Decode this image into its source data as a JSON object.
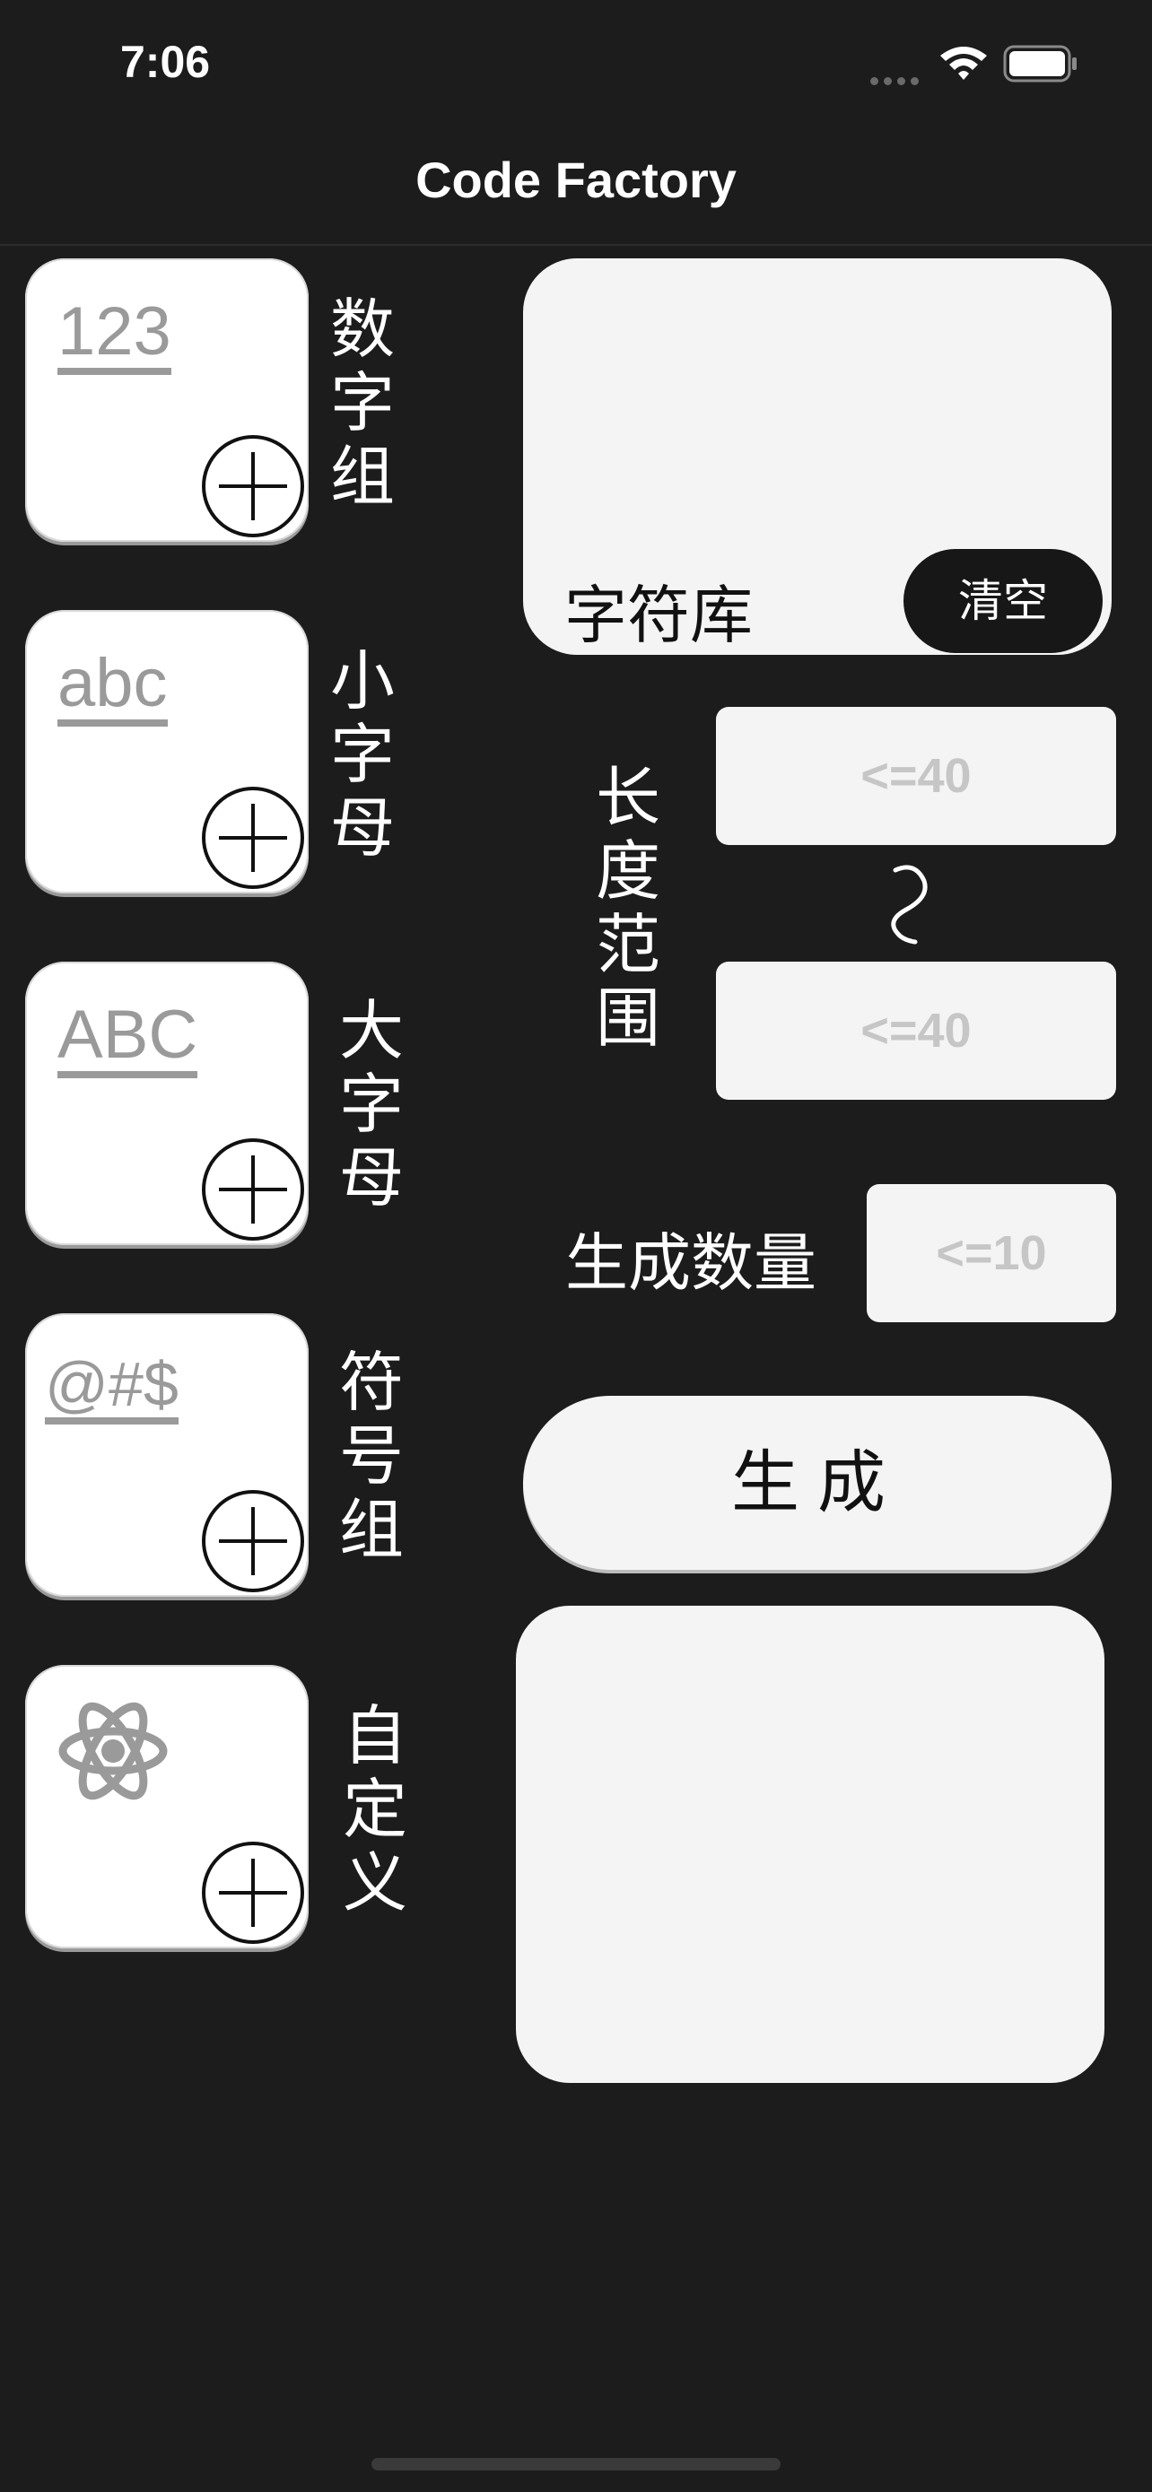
{
  "status_bar": {
    "time": "7:06"
  },
  "nav": {
    "title": "Code Factory"
  },
  "tiles": [
    {
      "glyph": "123",
      "label": "数字组"
    },
    {
      "glyph": "abc",
      "label": "小字母"
    },
    {
      "glyph": "ABC",
      "label": "大字母"
    },
    {
      "glyph": "@#$",
      "label": "符号组"
    },
    {
      "glyph": "",
      "label": "自定义"
    }
  ],
  "charset": {
    "label": "字符库",
    "clear_label": "清空"
  },
  "length_range": {
    "label": "长度范围",
    "min_placeholder": "<=40",
    "max_placeholder": "<=40"
  },
  "count": {
    "label": "生成数量",
    "placeholder": "<=10"
  },
  "generate": {
    "label": "生成"
  },
  "colors": {
    "background": "#1c1c1c",
    "panel": "#f4f4f4",
    "tile": "#ffffff",
    "tile_glyph": "#9a9a9a",
    "clear_button": "#171717"
  }
}
